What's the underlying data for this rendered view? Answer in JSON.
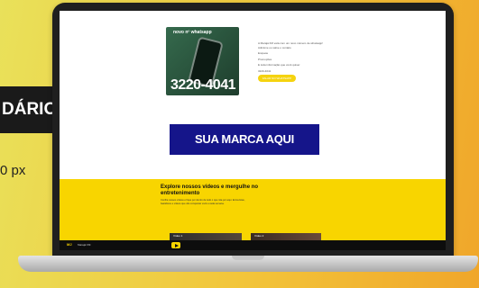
{
  "side": {
    "ad_label": "DÁRIO",
    "size_text": "0 px"
  },
  "promo": {
    "phone_title": "novo nº whatsapp",
    "phone_number": "3220-4041",
    "text_lines": [
      "A Marajá FM está com um novo número de whatsapp! Adicione ou salve o contato",
      "Enquete",
      "Promoções",
      "E toda informação que você quiser",
      "3220-4041"
    ],
    "button_label": "FALAR NO WHATSAPP"
  },
  "banner": {
    "text": "SUA MARCA AQUI"
  },
  "explore": {
    "title": "Explore nossos vídeos e mergulhe no entretenimento",
    "description": "Confira nossos vídeos e fique por dentro de tudo o que rola por aqui. Entrevistas, bastidores e vídeos que vão conquistar você a cada semana."
  },
  "videos": [
    {
      "title": "Vídeo 1"
    },
    {
      "title": "Vídeo 2"
    }
  ],
  "footer": {
    "logo": "MJ",
    "station": "Marajá FM"
  }
}
